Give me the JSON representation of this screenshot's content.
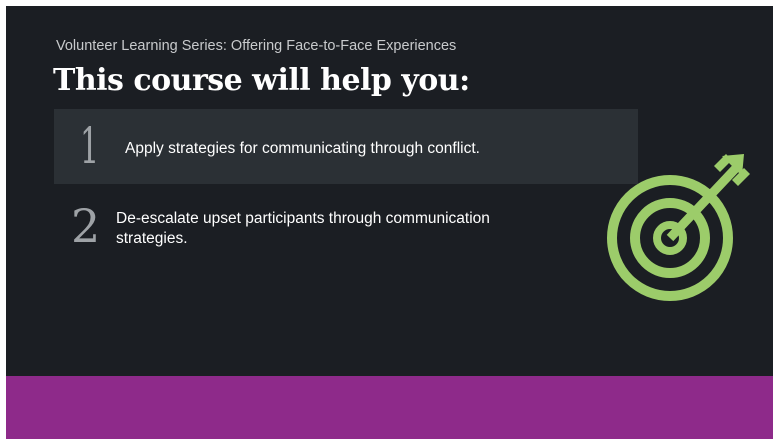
{
  "header": {
    "series_title": "Volunteer Learning Series:  Offering Face-to-Face Experiences",
    "heading": "This course will help you:"
  },
  "objectives": [
    {
      "number": "1",
      "text": "Apply strategies for communicating through conflict."
    },
    {
      "number": "2",
      "text": "De-escalate  upset participants through communication strategies."
    }
  ],
  "graphics": {
    "target_icon": "target-with-arrow-icon",
    "target_color": "#9ccc6a",
    "footer_color": "#8e2a8a",
    "background_color": "#1b1e23",
    "highlight_row_color": "#2b3035"
  }
}
